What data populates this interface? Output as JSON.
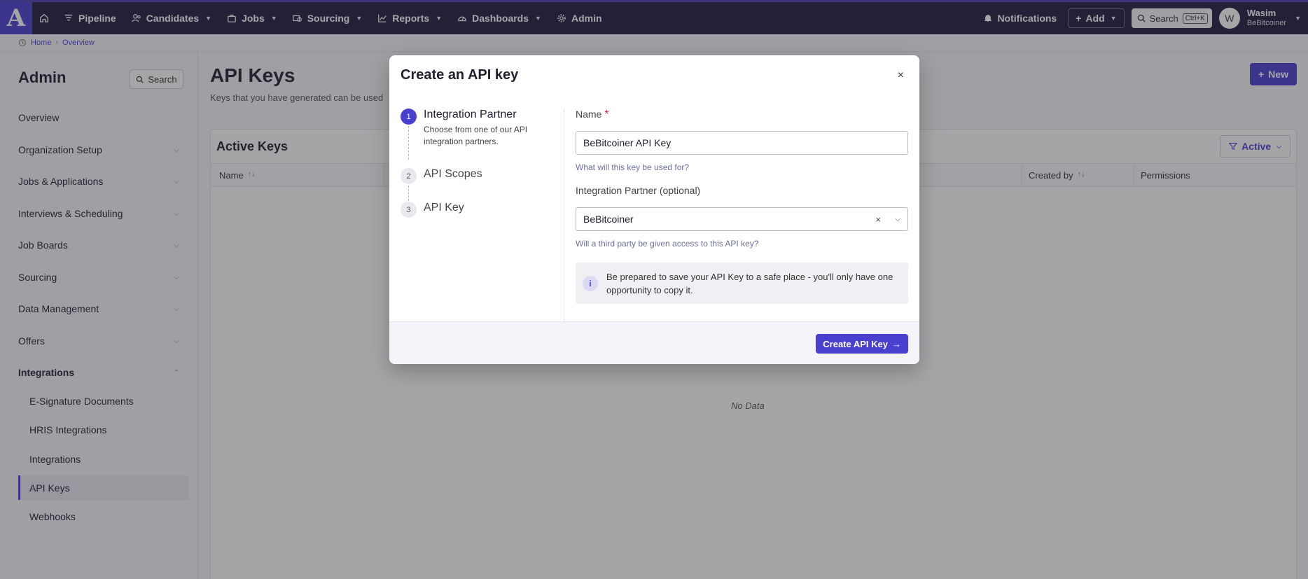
{
  "nav": {
    "logo": "A",
    "items": [
      {
        "label": "Pipeline",
        "dropdown": false
      },
      {
        "label": "Candidates",
        "dropdown": true
      },
      {
        "label": "Jobs",
        "dropdown": true
      },
      {
        "label": "Sourcing",
        "dropdown": true
      },
      {
        "label": "Reports",
        "dropdown": true
      },
      {
        "label": "Dashboards",
        "dropdown": true
      },
      {
        "label": "Admin",
        "dropdown": false
      }
    ],
    "notifications": "Notifications",
    "add": "Add",
    "search": "Search",
    "shortcut": "Ctrl+K",
    "user_initial": "W",
    "user_name": "Wasim",
    "user_org": "BeBitcoiner"
  },
  "breadcrumb": {
    "home": "Home",
    "sep": "›",
    "current": "Overview"
  },
  "sidebar": {
    "title": "Admin",
    "search": "Search",
    "items": [
      {
        "label": "Overview"
      },
      {
        "label": "Organization Setup"
      },
      {
        "label": "Jobs & Applications"
      },
      {
        "label": "Interviews & Scheduling"
      },
      {
        "label": "Job Boards"
      },
      {
        "label": "Sourcing"
      },
      {
        "label": "Data Management"
      },
      {
        "label": "Offers"
      },
      {
        "label": "Integrations"
      }
    ],
    "sub_items": [
      {
        "label": "E-Signature Documents"
      },
      {
        "label": "HRIS Integrations"
      },
      {
        "label": "Integrations"
      },
      {
        "label": "API Keys"
      },
      {
        "label": "Webhooks"
      }
    ]
  },
  "main": {
    "title": "API Keys",
    "subtitle": "Keys that you have generated can be used",
    "new_button": "New",
    "card_title": "Active Keys",
    "filter": "Active",
    "columns": [
      "Name",
      "Created by",
      "Permissions"
    ],
    "empty": "No Data"
  },
  "modal": {
    "title": "Create an API key",
    "close": "×",
    "steps": [
      {
        "num": "1",
        "label": "Integration Partner",
        "desc": "Choose from one of our API integration partners."
      },
      {
        "num": "2",
        "label": "API Scopes"
      },
      {
        "num": "3",
        "label": "API Key"
      }
    ],
    "name_label": "Name",
    "required": "*",
    "name_value": "BeBitcoiner API Key",
    "name_hint": "What will this key be used for?",
    "partner_label": "Integration Partner (optional)",
    "partner_value": "BeBitcoiner",
    "partner_hint": "Will a third party be given access to this API key?",
    "info_icon": "i",
    "info_text": "Be prepared to save your API Key to a safe place - you'll only have one opportunity to copy it.",
    "submit": "Create API Key"
  }
}
